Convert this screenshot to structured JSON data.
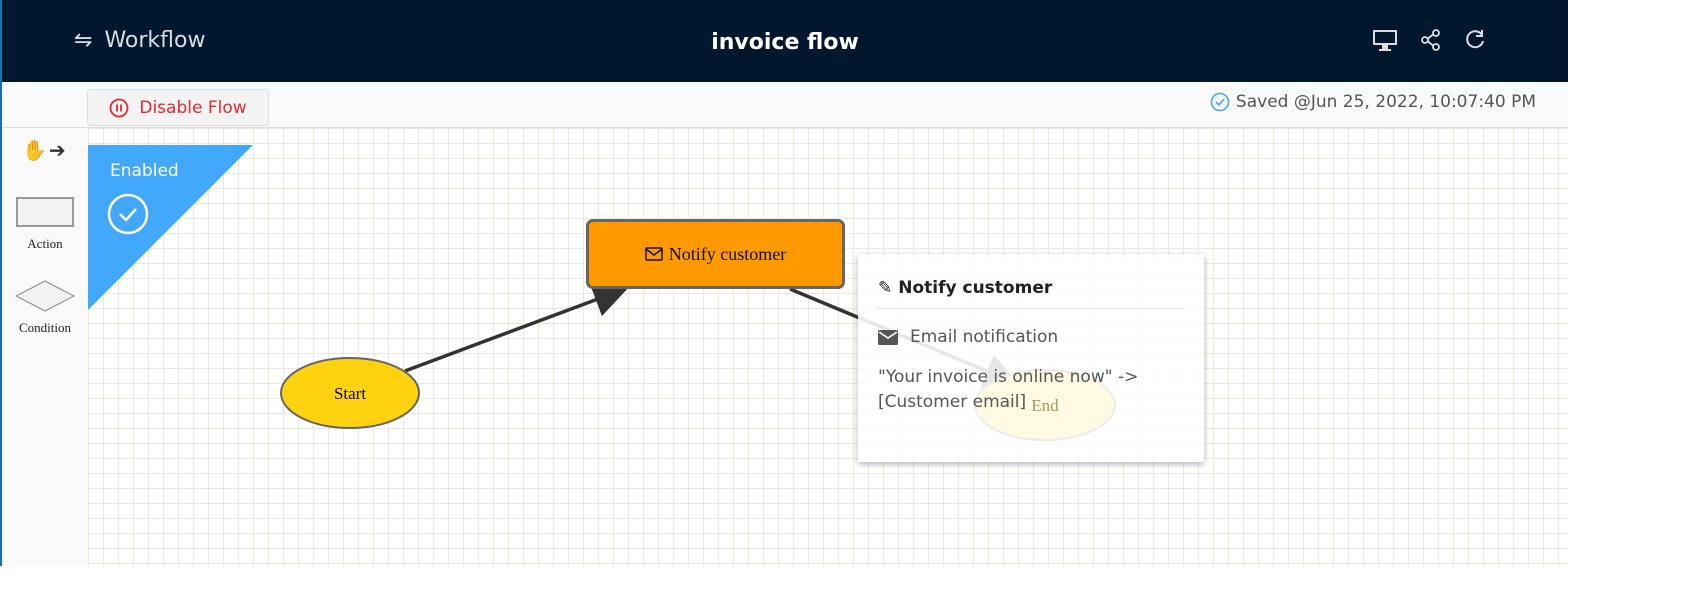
{
  "header": {
    "app_name": "Workflow",
    "title": "invoice flow",
    "icons": [
      "swap-icon",
      "monitor-icon",
      "share-icon",
      "refresh-icon"
    ]
  },
  "toolbar": {
    "disable_label": "Disable Flow",
    "saved_text": "Saved @Jun 25, 2022, 10:07:40 PM"
  },
  "palette": {
    "items": [
      {
        "label": "Action"
      },
      {
        "label": "Condition"
      }
    ]
  },
  "canvas": {
    "status_badge": "Enabled",
    "nodes": {
      "start": "Start",
      "notify": "Notify customer",
      "end": "End"
    }
  },
  "popup": {
    "title": "Notify customer",
    "type": "Email notification",
    "detail": "\"Your invoice is online now\" -> [Customer email]"
  },
  "colors": {
    "header": "#00172d",
    "enabled": "#42a8fb",
    "action_node": "#ff9900",
    "start_node": "#ffd20f",
    "danger": "#e8262f"
  }
}
